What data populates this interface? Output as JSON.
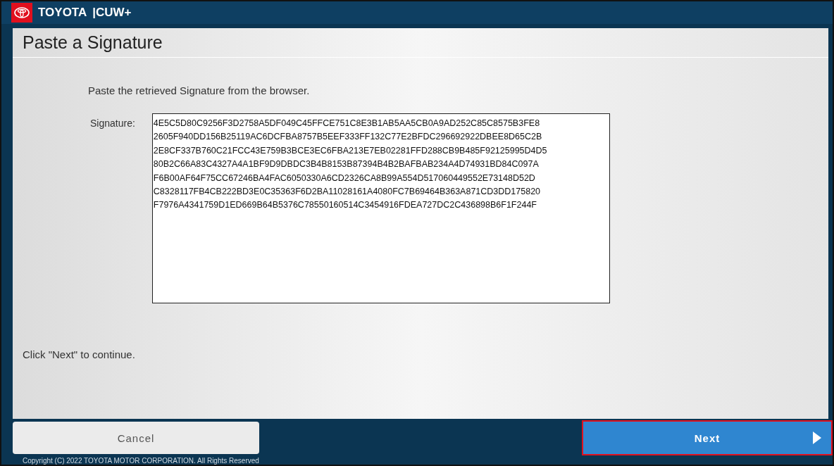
{
  "header": {
    "brand": "TOYOTA",
    "product": "|CUW+"
  },
  "page": {
    "title": "Paste a Signature",
    "instruction": "Paste the retrieved Signature from the browser.",
    "field_label": "Signature:",
    "signature_lines": [
      "4E5C5D80C9256F3D2758A5DF049C45FFCE751C8E3B1AB5AA5CB0A9AD252C85C8575B3FE8",
      "2605F940DD156B25119AC6DCFBA8757B5EEF333FF132C77E2BFDC296692922DBEE8D65C2B",
      "2E8CF337B760C21FCC43E759B3BCE3EC6FBA213E7EB02281FFD288CB9B485F92125995D4D5",
      "80B2C66A83C4327A4A1BF9D9DBDC3B4B8153B87394B4B2BAFBAB234A4D74931BD84C097A",
      "F6B00AF64F75CC67246BA4FAC6050330A6CD2326CA8B99A554D517060449552E73148D52D",
      "C8328117FB4CB222BD3E0C35363F6D2BA11028161A4080FC7B69464B363A871CD3DD175820",
      "F7976A4341759D1ED669B64B5376C78550160514C3454916FDEA727DC2C436898B6F1F244F"
    ],
    "footer_note": "Click \"Next\" to continue."
  },
  "buttons": [
    {
      "kind": "cancel",
      "label": "Cancel",
      "highlighted": false
    },
    {
      "kind": "next",
      "label": "Next",
      "highlighted": true
    }
  ],
  "copyright": "Copyright (C) 2022 TOYOTA MOTOR CORPORATION. All Rights Reserved"
}
